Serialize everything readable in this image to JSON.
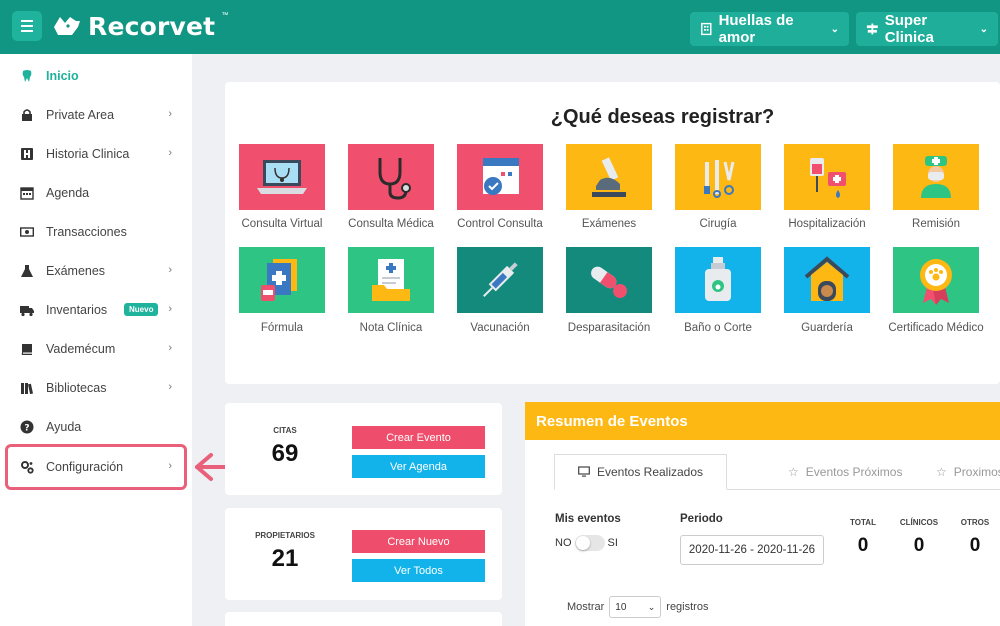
{
  "brand": {
    "name": "Recorvet",
    "tm": "™"
  },
  "header": {
    "owner_label": "Huellas de amor",
    "clinic_label": "Super Clinica"
  },
  "sidebar": {
    "items": [
      {
        "label": "Inicio",
        "icon": "tooth-icon",
        "has_arrow": false
      },
      {
        "label": "Private Area",
        "icon": "lock-icon",
        "has_arrow": true
      },
      {
        "label": "Historia Clinica",
        "icon": "hospital-icon",
        "has_arrow": true
      },
      {
        "label": "Agenda",
        "icon": "calendar-icon",
        "has_arrow": false
      },
      {
        "label": "Transacciones",
        "icon": "money-icon",
        "has_arrow": false
      },
      {
        "label": "Exámenes",
        "icon": "flask-icon",
        "has_arrow": true
      },
      {
        "label": "Inventarios",
        "icon": "truck-icon",
        "has_arrow": true,
        "badge": "Nuevo"
      },
      {
        "label": "Vademécum",
        "icon": "book-icon",
        "has_arrow": true
      },
      {
        "label": "Bibliotecas",
        "icon": "books-icon",
        "has_arrow": true
      },
      {
        "label": "Ayuda",
        "icon": "question-icon",
        "has_arrow": false
      },
      {
        "label": "Configuración",
        "icon": "gears-icon",
        "has_arrow": true
      }
    ]
  },
  "register": {
    "title": "¿Qué deseas registrar?",
    "tiles": [
      {
        "label": "Consulta Virtual",
        "color": "#f0506e"
      },
      {
        "label": "Consulta Médica",
        "color": "#f0506e"
      },
      {
        "label": "Control Consulta",
        "color": "#f0506e"
      },
      {
        "label": "Exámenes",
        "color": "#fdb813"
      },
      {
        "label": "Cirugía",
        "color": "#fdb813"
      },
      {
        "label": "Hospitalización",
        "color": "#fdb813"
      },
      {
        "label": "Remisión",
        "color": "#fdb813"
      },
      {
        "label": "Fórmula",
        "color": "#2ec584"
      },
      {
        "label": "Nota Clínica",
        "color": "#2ec584"
      },
      {
        "label": "Vacunación",
        "color": "#138a7c"
      },
      {
        "label": "Desparasitación",
        "color": "#138a7c"
      },
      {
        "label": "Baño o Corte",
        "color": "#12b3ea"
      },
      {
        "label": "Guardería",
        "color": "#12b3ea"
      },
      {
        "label": "Certificado Médico",
        "color": "#2ec584"
      }
    ]
  },
  "stats": {
    "citas": {
      "label": "CITAS",
      "value": "69",
      "btn1": "Crear Evento",
      "btn2": "Ver Agenda"
    },
    "propietarios": {
      "label": "PROPIETARIOS",
      "value": "21",
      "btn1": "Crear Nuevo",
      "btn2": "Ver Todos"
    }
  },
  "resumen": {
    "title": "Resumen de Eventos",
    "tabs": [
      "Eventos Realizados",
      "Eventos Próximos",
      "Proximos C"
    ],
    "mis_eventos_label": "Mis eventos",
    "toggle_no": "NO",
    "toggle_si": "SI",
    "periodo_label": "Periodo",
    "periodo_value": "2020-11-26 - 2020-11-26",
    "counts": [
      {
        "label": "TOTAL",
        "value": "0"
      },
      {
        "label": "CLÍNICOS",
        "value": "0"
      },
      {
        "label": "OTROS",
        "value": "0"
      }
    ],
    "mostrar_label": "Mostrar",
    "mostrar_value": "10",
    "registros_label": "registros"
  },
  "colors": {
    "header": "#119683",
    "accent": "#1fb29d",
    "highlight": "#e8607a",
    "resumen_head": "#fdb813",
    "btn_red": "#ee4e6b",
    "btn_blue": "#12b3ea"
  }
}
